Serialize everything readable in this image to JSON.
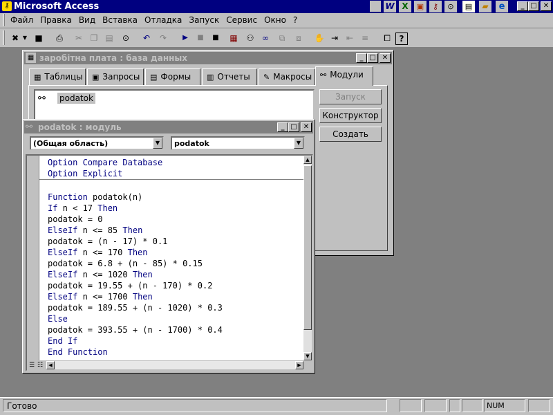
{
  "app": {
    "title": "Microsoft Access"
  },
  "menu": [
    "Файл",
    "Правка",
    "Вид",
    "Вставка",
    "Отладка",
    "Запуск",
    "Сервис",
    "Окно",
    "?"
  ],
  "titlebar_icons": [
    "word-icon",
    "excel-icon",
    "powerpoint-icon",
    "access-icon",
    "binoculars-icon",
    "notepad-icon",
    "folder-icon",
    "ie-icon"
  ],
  "db_window": {
    "title": "заробітна плата : база данных",
    "tabs": [
      "Таблицы",
      "Запросы",
      "Формы",
      "Отчеты",
      "Макросы",
      "Модули"
    ],
    "active_tab": "Модули",
    "items": [
      "podatok"
    ],
    "buttons": {
      "run": "Запуск",
      "design": "Конструктор",
      "create": "Создать"
    }
  },
  "module_window": {
    "title": "podatok : модуль",
    "object_select": "(Общая область)",
    "proc_select": "podatok",
    "declarations": [
      [
        {
          "t": "Option Compare Database",
          "k": true
        }
      ],
      [
        {
          "t": "Option Explicit",
          "k": true
        }
      ]
    ],
    "code": [
      [
        {
          "t": "",
          "k": false
        }
      ],
      [
        {
          "t": "Function",
          "k": true
        },
        {
          "t": " podatok(n)",
          "k": false
        }
      ],
      [
        {
          "t": "If",
          "k": true
        },
        {
          "t": " n < 17 ",
          "k": false
        },
        {
          "t": "Then",
          "k": true
        }
      ],
      [
        {
          "t": "podatok = 0",
          "k": false
        }
      ],
      [
        {
          "t": "ElseIf",
          "k": true
        },
        {
          "t": " n <= 85 ",
          "k": false
        },
        {
          "t": "Then",
          "k": true
        }
      ],
      [
        {
          "t": "podatok = (n - 17) * 0.1",
          "k": false
        }
      ],
      [
        {
          "t": "ElseIf",
          "k": true
        },
        {
          "t": " n <= 170 ",
          "k": false
        },
        {
          "t": "Then",
          "k": true
        }
      ],
      [
        {
          "t": "podatok = 6.8 + (n - 85) * 0.15",
          "k": false
        }
      ],
      [
        {
          "t": "ElseIf",
          "k": true
        },
        {
          "t": " n <= 1020 ",
          "k": false
        },
        {
          "t": "Then",
          "k": true
        }
      ],
      [
        {
          "t": "podatok = 19.55 + (n - 170) * 0.2",
          "k": false
        }
      ],
      [
        {
          "t": "ElseIf",
          "k": true
        },
        {
          "t": " n <= 1700 ",
          "k": false
        },
        {
          "t": "Then",
          "k": true
        }
      ],
      [
        {
          "t": "podatok = 189.55 + (n - 1020) * 0.3",
          "k": false
        }
      ],
      [
        {
          "t": "Else",
          "k": true
        }
      ],
      [
        {
          "t": "podatok = 393.55 + (n - 1700) * 0.4",
          "k": false
        }
      ],
      [
        {
          "t": "End If",
          "k": true
        }
      ],
      [
        {
          "t": "End Function",
          "k": true
        }
      ]
    ]
  },
  "status": {
    "text": "Готово",
    "num": "NUM"
  }
}
